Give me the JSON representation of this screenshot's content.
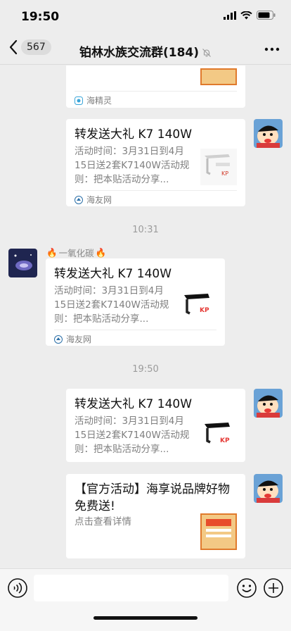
{
  "status_bar": {
    "time": "19:50"
  },
  "header": {
    "unread_count": "567",
    "title": "铂林水族交流群(184)"
  },
  "messages": [
    {
      "type": "link_card_partial",
      "side": "right",
      "source": "海精灵"
    },
    {
      "type": "link_card",
      "side": "right",
      "title": "转发送大礼 K7 140W",
      "desc": "活动时间：3月31日到4月15日送2套K7140W活动规则：把本贴活动分享...",
      "source": "海友网",
      "thumb_icon": "aquarium-light-icon"
    },
    {
      "type": "time_separator",
      "text": "10:31"
    },
    {
      "type": "link_card",
      "side": "left",
      "sender": "一氧化碳",
      "title": "转发送大礼 K7 140W",
      "desc": "活动时间：3月31日到4月15日送2套K7140W活动规则：把本贴活动分享...",
      "source": "海友网",
      "thumb_icon": "aquarium-light-icon"
    },
    {
      "type": "time_separator",
      "text": "19:50"
    },
    {
      "type": "link_card",
      "side": "right",
      "title": "转发送大礼 K7 140W",
      "desc": "活动时间：3月31日到4月15日送2套K7140W活动规则：把本贴活动分享...",
      "thumb_icon": "aquarium-light-icon"
    },
    {
      "type": "link_card",
      "side": "right",
      "title": "【官方活动】海享说品牌好物免费送!",
      "desc": "点击查看详情",
      "thumb_icon": "promo-poster-icon"
    }
  ],
  "thumb_brand": "KP",
  "colors": {
    "background": "#ededed",
    "card": "#ffffff",
    "muted_text": "#7f7f7f",
    "fire_emoji": "🔥"
  }
}
